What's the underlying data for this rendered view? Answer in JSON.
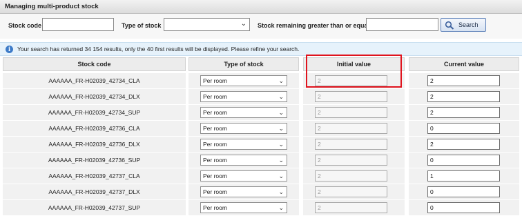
{
  "page": {
    "title": "Managing multi-product stock"
  },
  "filters": {
    "stock_code_label": "Stock code",
    "stock_code_value": "",
    "type_of_stock_label": "Type of stock",
    "type_of_stock_value": "",
    "remaining_label": "Stock remaining greater than or equal",
    "remaining_value": "",
    "search_button": "Search"
  },
  "info": {
    "message": "Your search has returned 34 154 results, only the 40 first results will be displayed. Please refine your search."
  },
  "table": {
    "headers": [
      "Stock code",
      "Type of stock",
      "Initial value",
      "Current value"
    ],
    "rows": [
      {
        "code": "AAAAAA_FR-H02039_42734_CLA",
        "type": "Per room",
        "initial": "2",
        "current": "2"
      },
      {
        "code": "AAAAAA_FR-H02039_42734_DLX",
        "type": "Per room",
        "initial": "2",
        "current": "2"
      },
      {
        "code": "AAAAAA_FR-H02039_42734_SUP",
        "type": "Per room",
        "initial": "2",
        "current": "2"
      },
      {
        "code": "AAAAAA_FR-H02039_42736_CLA",
        "type": "Per room",
        "initial": "2",
        "current": "0"
      },
      {
        "code": "AAAAAA_FR-H02039_42736_DLX",
        "type": "Per room",
        "initial": "2",
        "current": "2"
      },
      {
        "code": "AAAAAA_FR-H02039_42736_SUP",
        "type": "Per room",
        "initial": "2",
        "current": "0"
      },
      {
        "code": "AAAAAA_FR-H02039_42737_CLA",
        "type": "Per room",
        "initial": "2",
        "current": "1"
      },
      {
        "code": "AAAAAA_FR-H02039_42737_DLX",
        "type": "Per room",
        "initial": "2",
        "current": "0"
      },
      {
        "code": "AAAAAA_FR-H02039_42737_SUP",
        "type": "Per room",
        "initial": "2",
        "current": "0"
      }
    ]
  },
  "colors": {
    "highlight": "#e0141e",
    "info_bg": "#e6f2fb",
    "button_border": "#5b7fb8"
  }
}
